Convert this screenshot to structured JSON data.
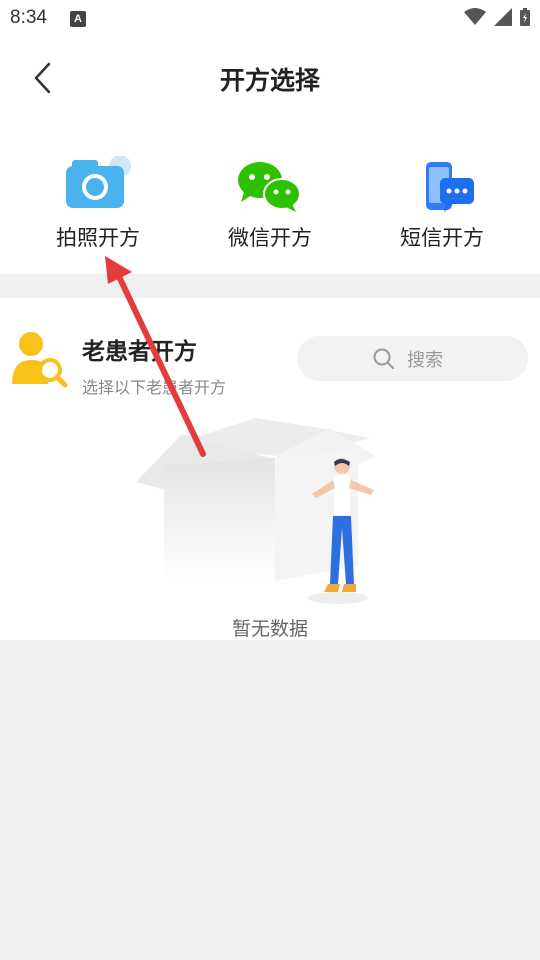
{
  "status_bar": {
    "time": "8:34",
    "notification_letter": "A"
  },
  "header": {
    "title": "开方选择"
  },
  "options": [
    {
      "label": "拍照开方",
      "icon": "camera-icon"
    },
    {
      "label": "微信开方",
      "icon": "wechat-icon"
    },
    {
      "label": "短信开方",
      "icon": "sms-icon"
    }
  ],
  "patients": {
    "title": "老患者开方",
    "subtitle": "选择以下老患者开方",
    "search_placeholder": "搜索",
    "empty_text": "暂无数据"
  },
  "colors": {
    "camera": "#4ab3ee",
    "wechat": "#2dc100",
    "sms": "#2f7cf6",
    "patient": "#f9c21b",
    "arrow": "#e43b3b"
  }
}
